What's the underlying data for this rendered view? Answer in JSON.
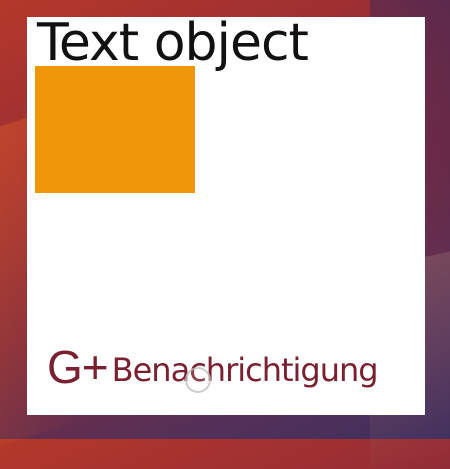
{
  "widget": {
    "title": "Text object",
    "rect_color": "#ef9709",
    "footer": {
      "icon": "G+",
      "icon_name": "google-plus-icon",
      "label": "Benachrichtigung",
      "color": "#7a2030"
    }
  },
  "colors": {
    "widget_background": "#ffffff",
    "title_text": "#111111"
  }
}
